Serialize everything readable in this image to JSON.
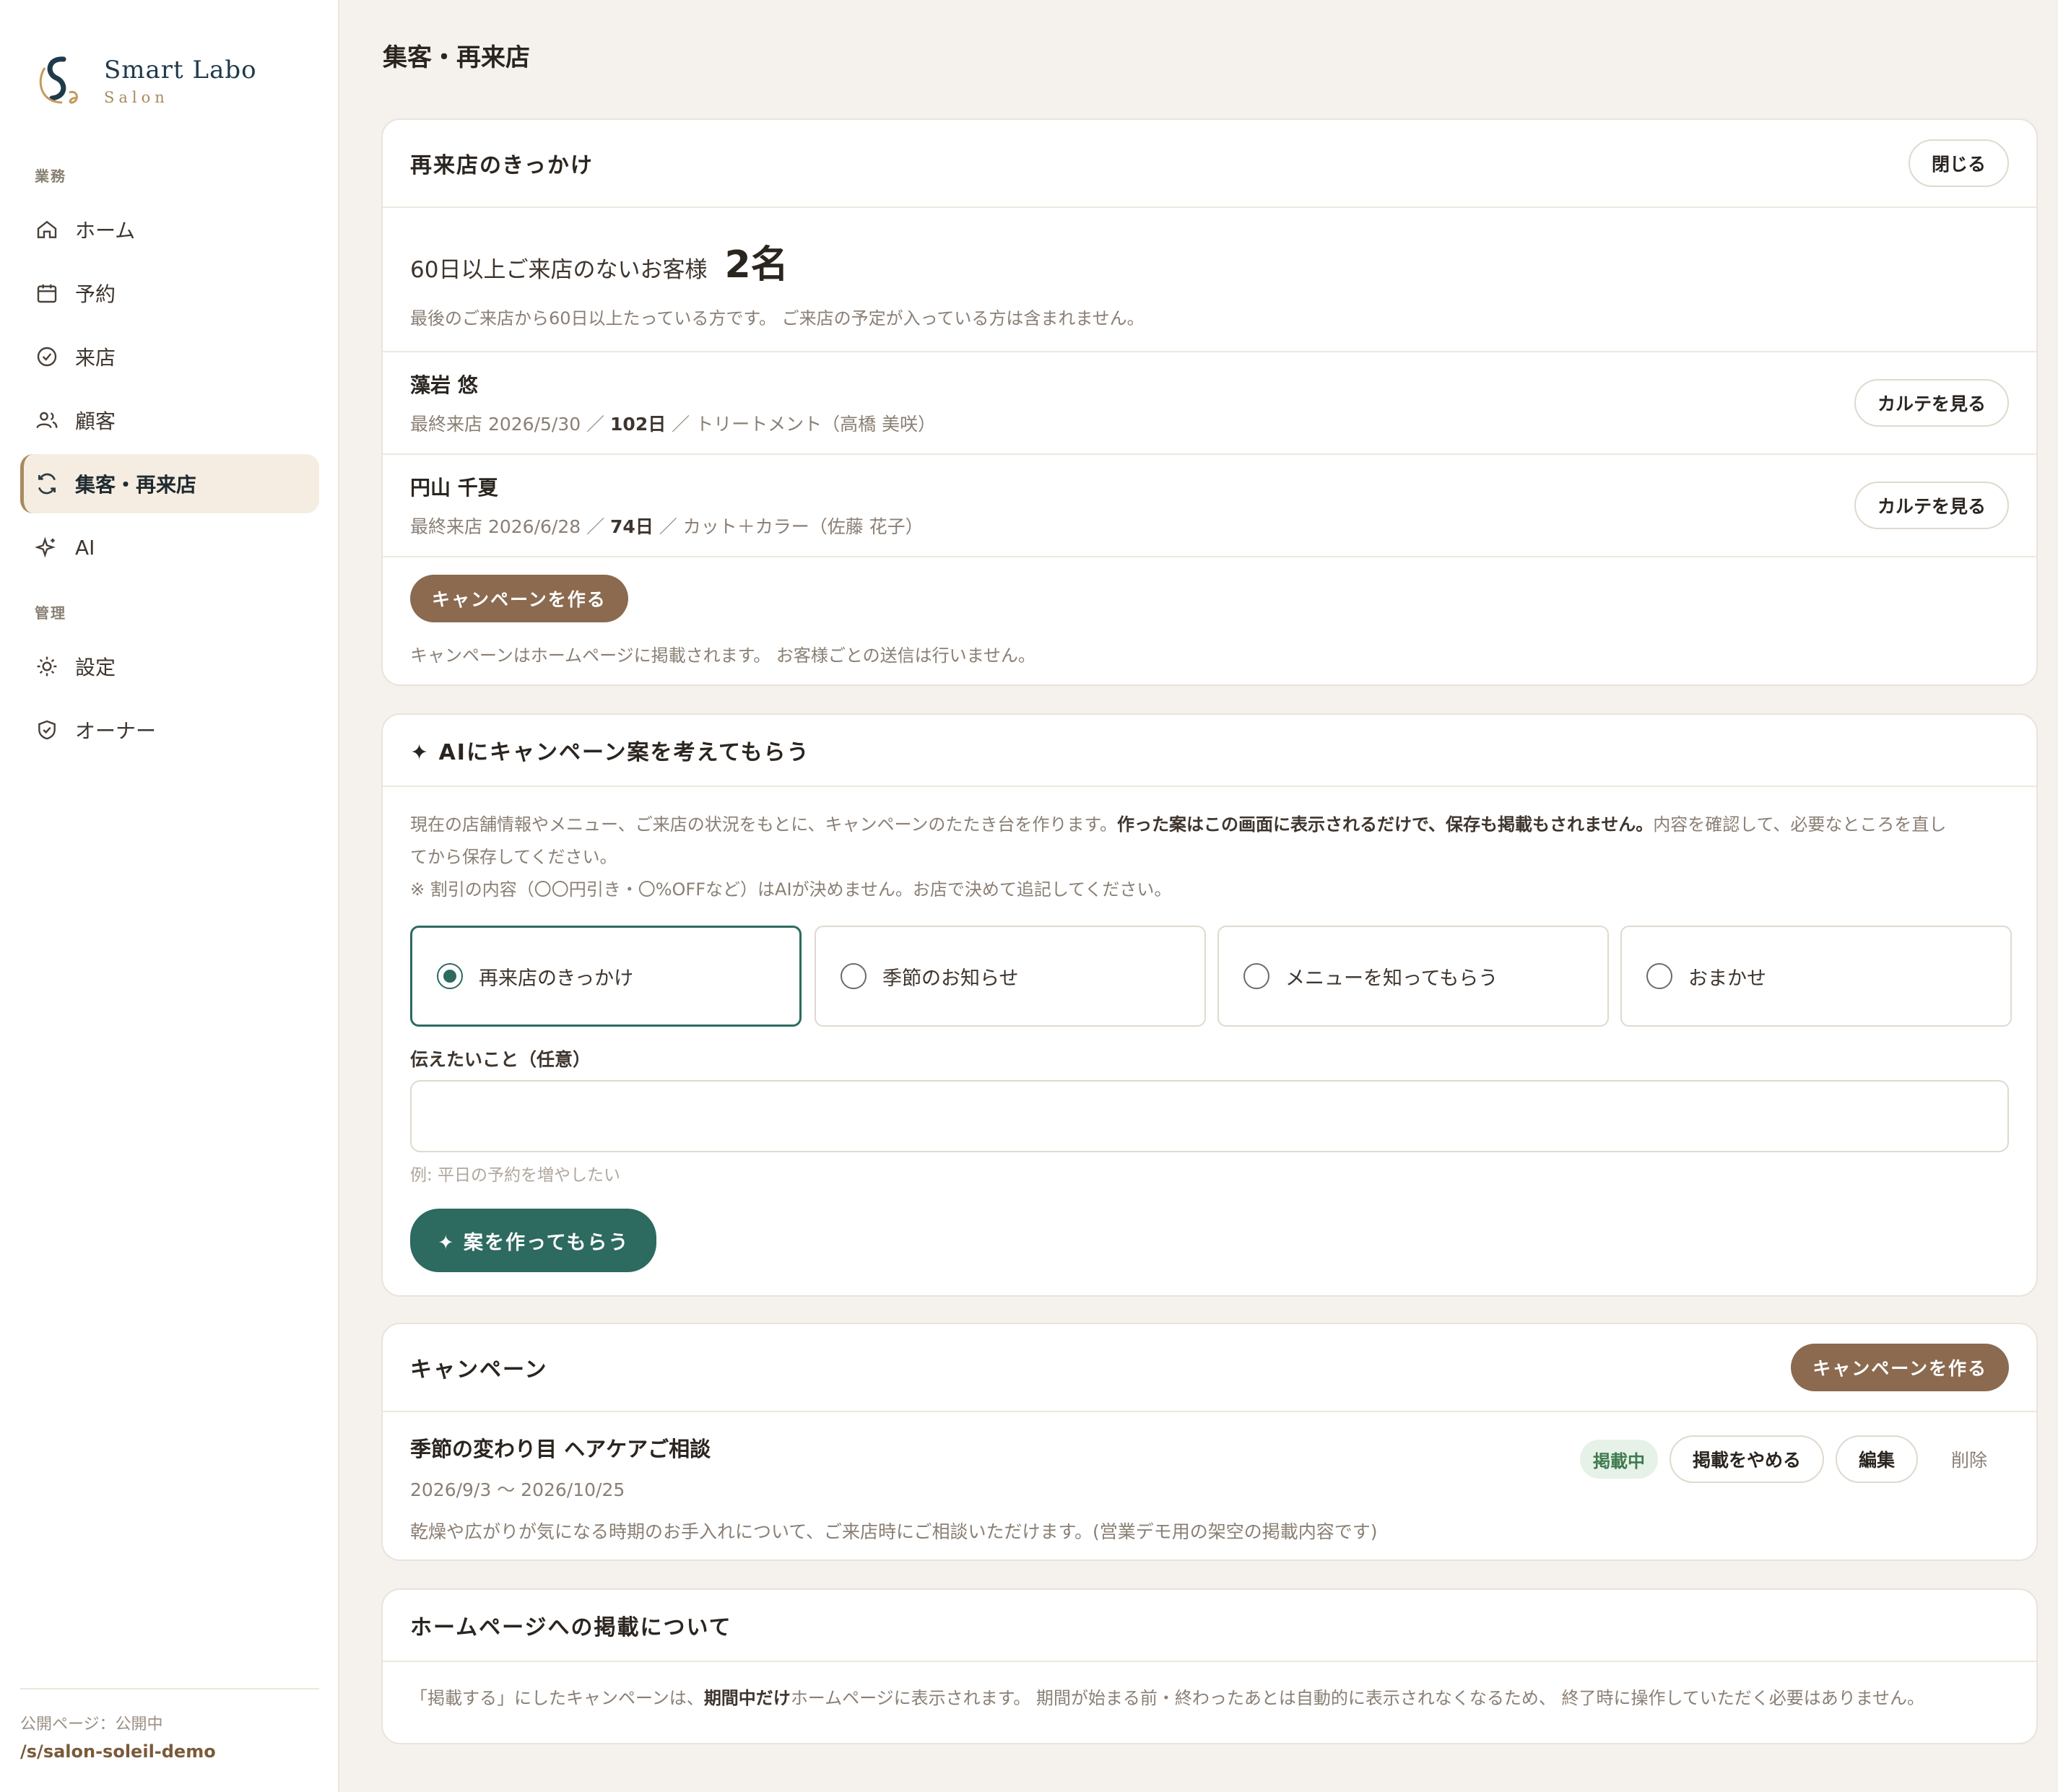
{
  "brand": {
    "title": "Smart Labo",
    "sub": "Salon"
  },
  "sidebar": {
    "section_work": "業務",
    "section_admin": "管理",
    "items": [
      {
        "label": "ホーム",
        "icon": "home-icon"
      },
      {
        "label": "予約",
        "icon": "calendar-icon"
      },
      {
        "label": "来店",
        "icon": "check-circle-icon"
      },
      {
        "label": "顧客",
        "icon": "users-icon"
      },
      {
        "label": "集客・再来店",
        "icon": "refresh-icon"
      },
      {
        "label": "AI",
        "icon": "sparkle-icon"
      },
      {
        "label": "設定",
        "icon": "sun-icon"
      },
      {
        "label": "オーナー",
        "icon": "shield-check-icon"
      }
    ],
    "public_label": "公開ページ：公開中",
    "public_link": "/s/salon-soleil-demo"
  },
  "page": {
    "title": "集客・再来店"
  },
  "revisit": {
    "title": "再来店のきっかけ",
    "close_label": "閉じる",
    "count_label": "60日以上ご来店のないお客様",
    "count_value": "2名",
    "note": "最後のご来店から60日以上たっている方です。 ご来店の予定が入っている方は含まれません。",
    "customers": [
      {
        "name": "藻岩 悠",
        "prefix": "最終来店 2026/5/30 ／ ",
        "days": "102日",
        "suffix": " ／ トリートメント（高橋 美咲）",
        "button": "カルテを見る"
      },
      {
        "name": "円山 千夏",
        "prefix": "最終来店 2026/6/28 ／ ",
        "days": "74日",
        "suffix": " ／ カット＋カラー（佐藤 花子）",
        "button": "カルテを見る"
      }
    ],
    "create_label": "キャンペーンを作る",
    "footer_note": "キャンペーンはホームページに掲載されます。 お客様ごとの送信は行いません。"
  },
  "ai": {
    "title": "✦ AIにキャンペーン案を考えてもらう",
    "desc_1": "現在の店舗情報やメニュー、ご来店の状況をもとに、キャンペーンのたたき台を作ります。",
    "desc_bold": "作った案はこの画面に表示されるだけで、保存も掲載もされません。",
    "desc_2": "内容を確認して、必要なところを直し",
    "desc_3": "てから保存してください。",
    "desc_note": "※ 割引の内容（〇〇円引き・〇%OFFなど）はAIが決めません。お店で決めて追記してください。",
    "options": [
      "再来店のきっかけ",
      "季節のお知らせ",
      "メニューを知ってもらう",
      "おまかせ"
    ],
    "selected_index": 0,
    "message_label": "伝えたいこと（任意）",
    "message_value": "",
    "message_hint": "例: 平日の予約を増やしたい",
    "generate_label": "✦ 案を作ってもらう"
  },
  "campaigns": {
    "title": "キャンペーン",
    "create_label": "キャンペーンを作る",
    "items": [
      {
        "name": "季節の変わり目 ヘアケアご相談",
        "period": "2026/9/3 〜 2026/10/25",
        "desc": "乾燥や広がりが気になる時期のお手入れについて、ご来店時にご相談いただけます。(営業デモ用の架空の掲載内容です)",
        "status": "掲載中",
        "unpublish_label": "掲載をやめる",
        "edit_label": "編集",
        "delete_label": "削除"
      }
    ]
  },
  "homepage": {
    "title": "ホームページへの掲載について",
    "text_1": "「掲載する」にしたキャンペーンは、",
    "text_bold": "期間中だけ",
    "text_2": "ホームページに表示されます。 期間が始まる前・終わったあとは自動的に表示されなくなるため、 終了時に操作していただく必要はありません。"
  },
  "colors": {
    "brand_brown": "#8b6a4f",
    "accent_green": "#2d6a5f",
    "navy": "#1f3a4a"
  }
}
